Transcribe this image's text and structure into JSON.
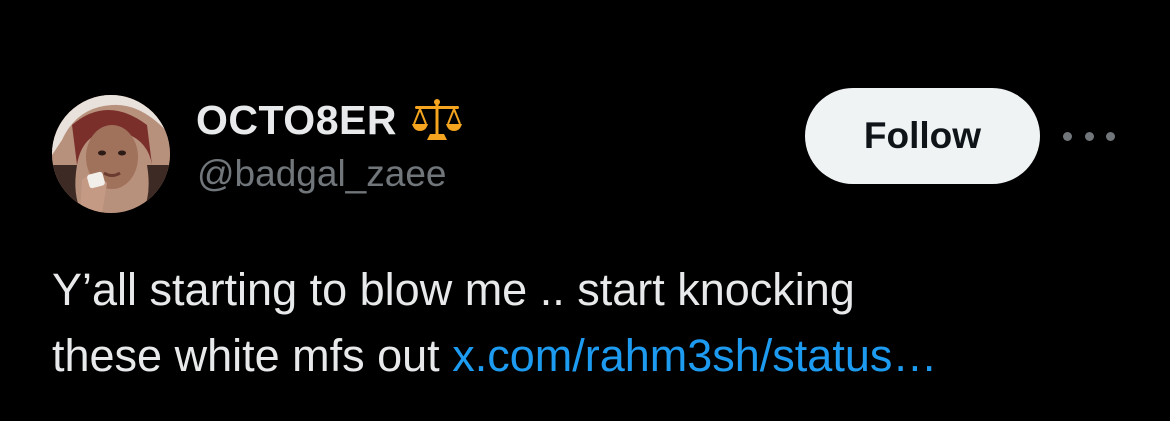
{
  "tweet": {
    "author": {
      "display_name": "OCTO8ER",
      "name_emoji": "scales-emoji",
      "handle": "@badgal_zaee",
      "avatar": "profile-photo"
    },
    "follow_label": "Follow",
    "more_icon": "more-horizontal-icon",
    "text_line1": "Y’all starting to blow me .. start knocking",
    "text_line2_prefix": "these white mfs out",
    "link_text": "x.com/rahm3sh/status…"
  },
  "colors": {
    "background": "#000000",
    "primary_text": "#e7e9ea",
    "secondary_text": "#71767b",
    "link": "#1d9bf0",
    "follow_bg": "#eff3f4",
    "follow_text": "#0f1419",
    "emoji_gold": "#f4a41f"
  }
}
